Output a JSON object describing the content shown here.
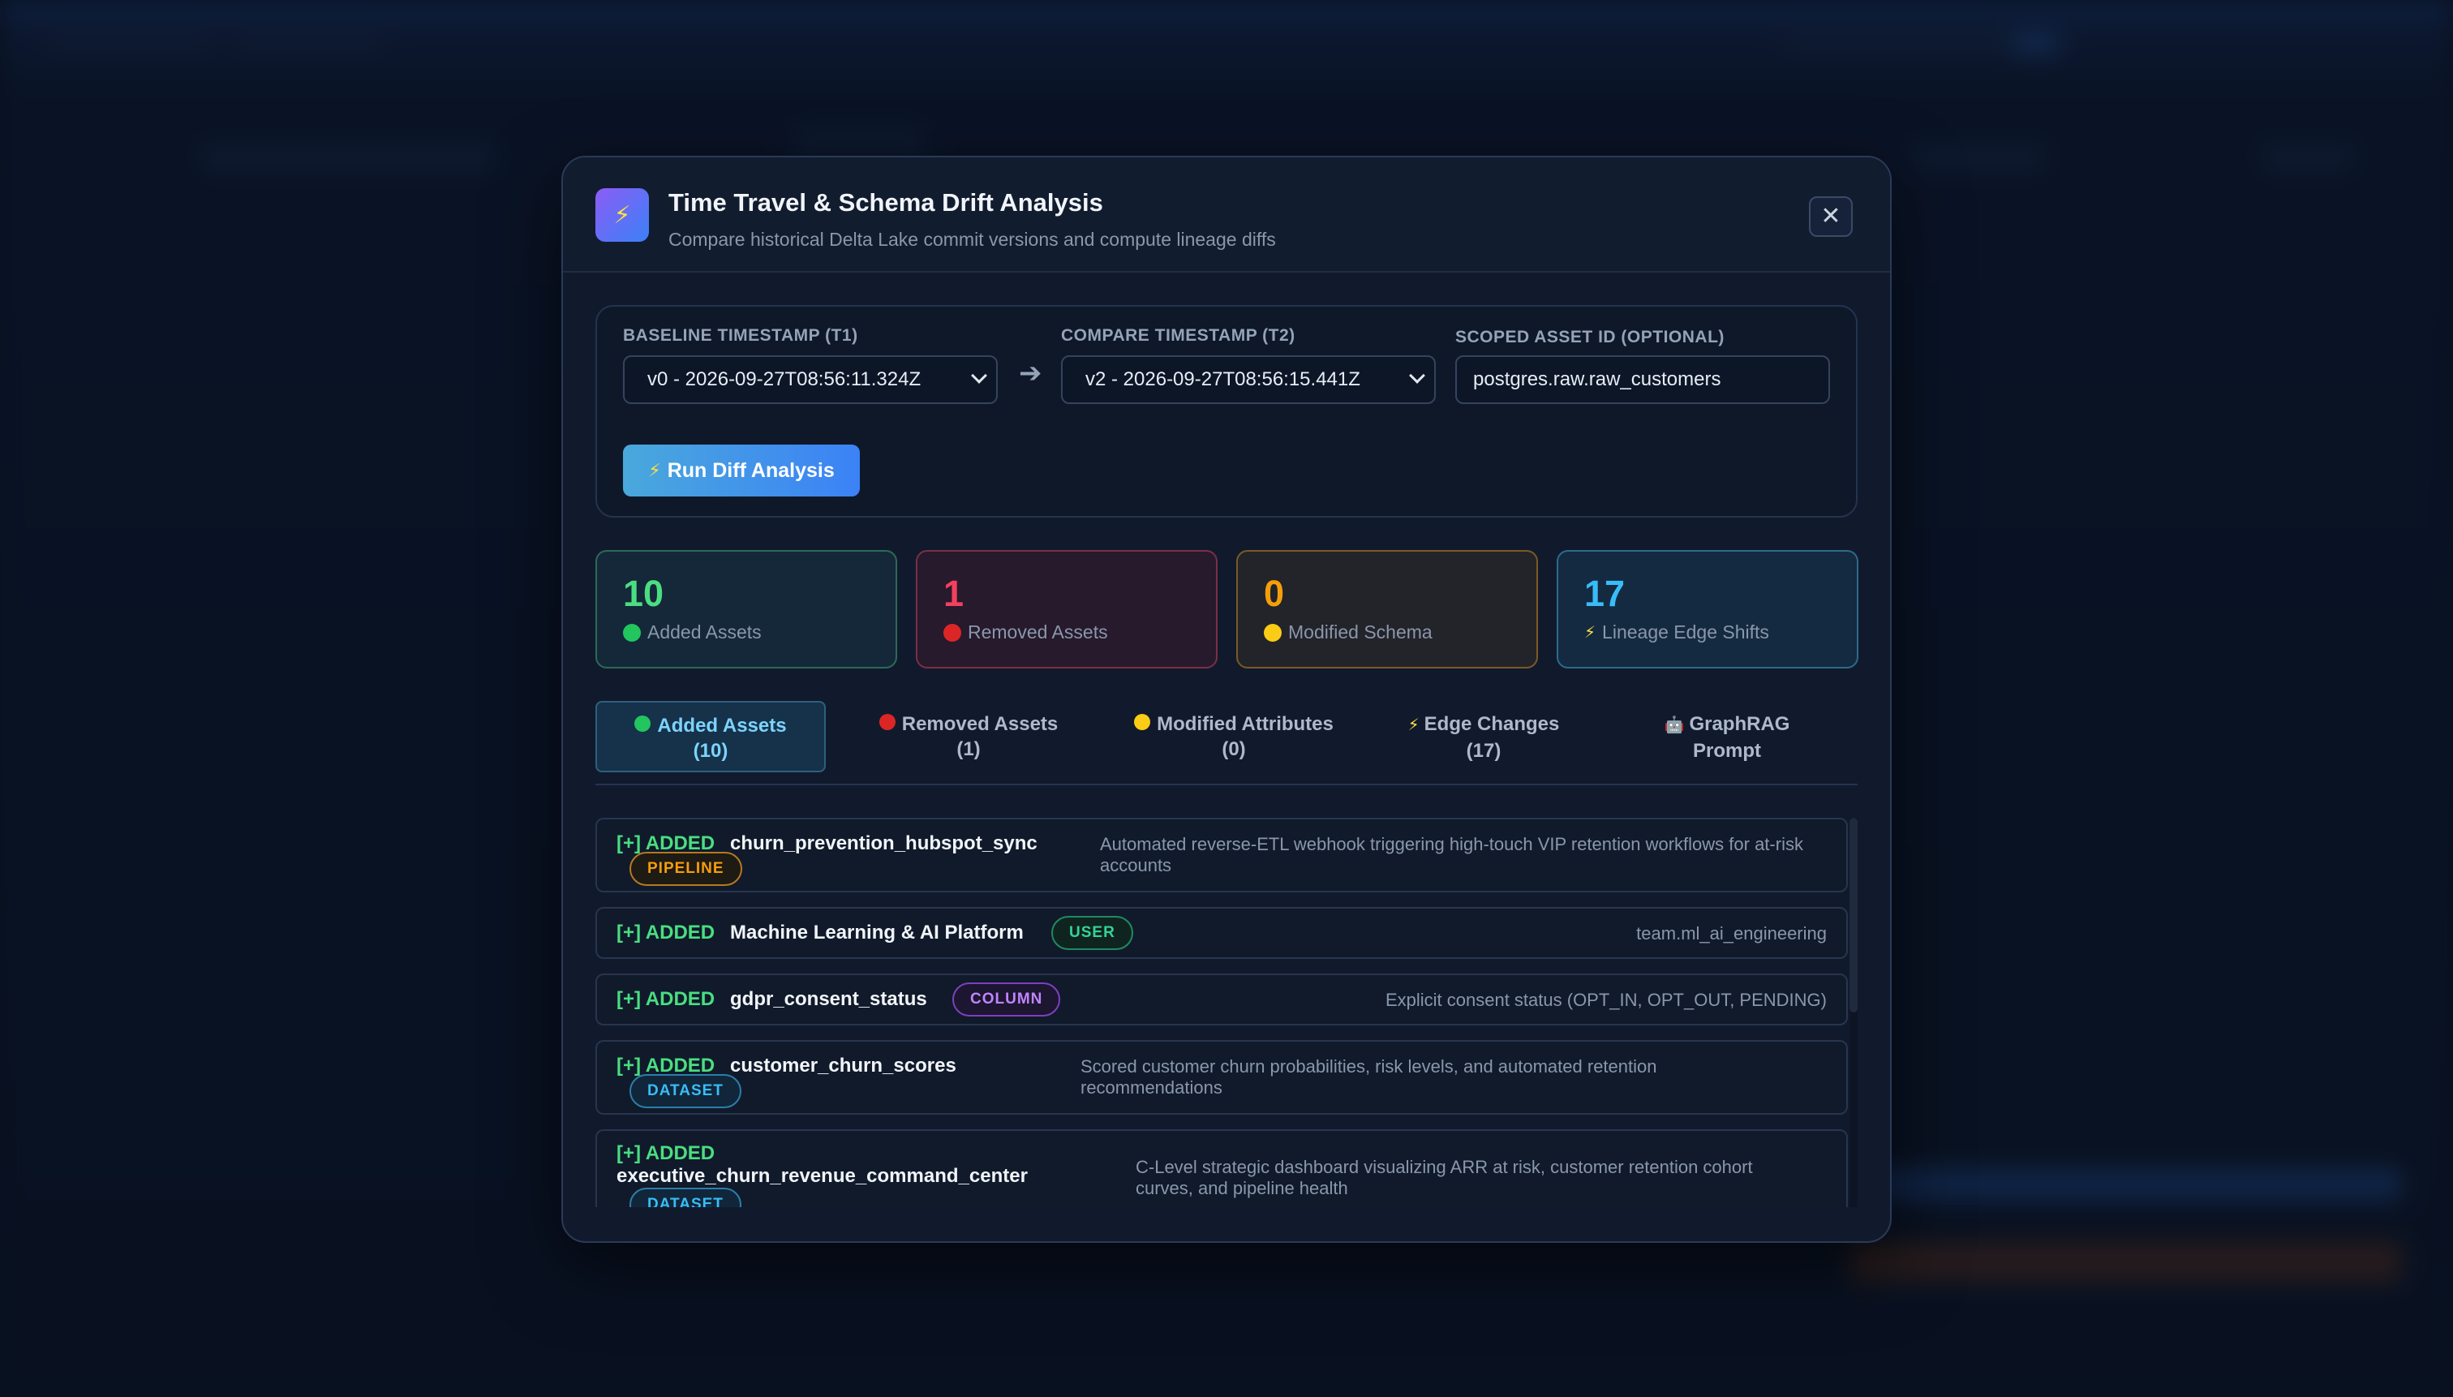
{
  "modal": {
    "logo_icon": "lightning-icon",
    "title": "Time Travel & Schema Drift Analysis",
    "subtitle": "Compare historical Delta Lake commit versions and compute lineage diffs",
    "close_label": "✕"
  },
  "controls": {
    "baseline_label": "BASELINE TIMESTAMP (T1)",
    "baseline_value": "v0 - 2026-09-27T08:56:11.324Z",
    "compare_label": "COMPARE TIMESTAMP (T2)",
    "compare_value": "v2 - 2026-09-27T08:56:15.441Z",
    "scope_label": "SCOPED ASSET ID (OPTIONAL)",
    "scope_value": "postgres.raw.raw_customers",
    "run_label": "Run Diff Analysis"
  },
  "stats": [
    {
      "value": "10",
      "label": "Added Assets",
      "color": "#4ade80"
    },
    {
      "value": "1",
      "label": "Removed Assets",
      "color": "#f43f5e"
    },
    {
      "value": "0",
      "label": "Modified Schema",
      "color": "#f59e0b"
    },
    {
      "value": "17",
      "label": "Lineage Edge Shifts",
      "color": "#38bdf8"
    }
  ],
  "tabs": [
    {
      "label": "Added Assets",
      "count": "(10)",
      "icon": "green-circle-icon"
    },
    {
      "label": "Removed Assets",
      "count": "(1)",
      "icon": "red-circle-icon"
    },
    {
      "label": "Modified Attributes",
      "count": "(0)",
      "icon": "yellow-circle-icon"
    },
    {
      "label": "Edge Changes",
      "count": "(17)",
      "icon": "lightning-icon"
    },
    {
      "label": "GraphRAG",
      "count": "Prompt",
      "icon": "robot-icon"
    }
  ],
  "rows": [
    {
      "status": "[+] ADDED",
      "name": "churn_prevention_hubspot_sync",
      "badge": "PIPELINE",
      "desc": "Automated reverse-ETL webhook triggering high-touch VIP retention workflows for at-risk accounts"
    },
    {
      "status": "[+] ADDED",
      "name": "Machine Learning & AI Platform",
      "badge": "USER",
      "desc": "team.ml_ai_engineering"
    },
    {
      "status": "[+] ADDED",
      "name": "gdpr_consent_status",
      "badge": "COLUMN",
      "desc": "Explicit consent status (OPT_IN, OPT_OUT, PENDING)"
    },
    {
      "status": "[+] ADDED",
      "name": "customer_churn_scores",
      "badge": "DATASET",
      "desc": "Scored customer churn probabilities, risk levels, and automated retention recommendations"
    },
    {
      "status": "[+] ADDED",
      "name": "executive_churn_revenue_command_center",
      "badge": "DATASET",
      "desc": "C-Level strategic dashboard visualizing ARR at risk, customer retention cohort curves, and pipeline health"
    }
  ],
  "colors": {
    "added": "#4ade80",
    "pipeline": "#f59e0b",
    "user": "#34d399",
    "column": "#c084fc",
    "dataset": "#38bdf8"
  }
}
